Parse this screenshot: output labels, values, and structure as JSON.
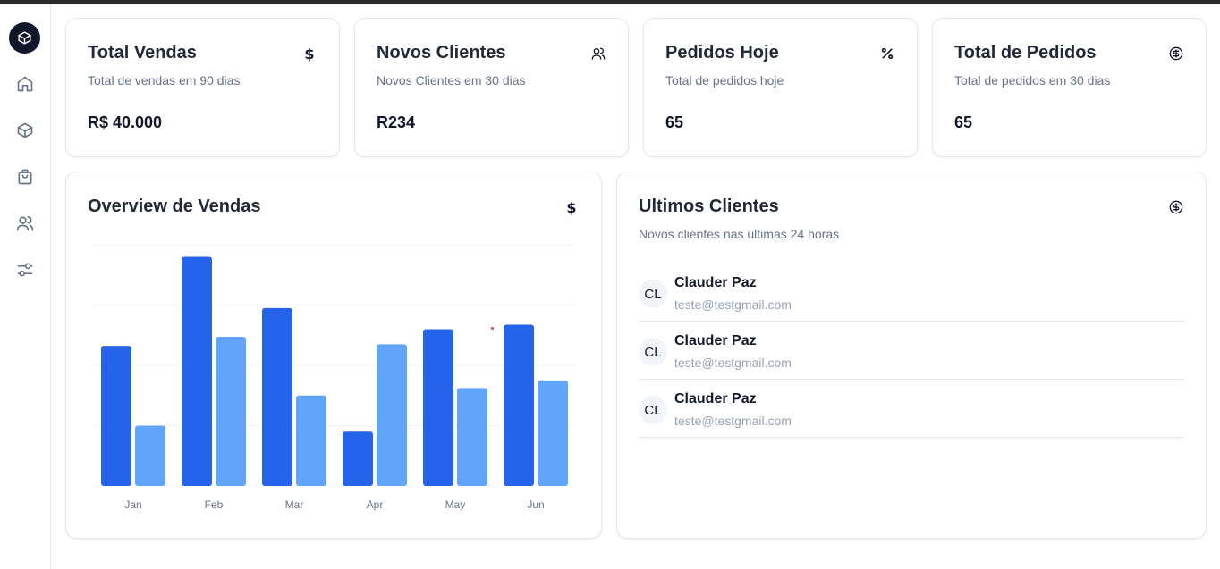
{
  "stats": [
    {
      "title": "Total Vendas",
      "subtitle": "Total de vendas em 90 dias",
      "value": "R$ 40.000",
      "icon": "dollar-icon"
    },
    {
      "title": "Novos Clientes",
      "subtitle": "Novos Clientes em 30 dias",
      "value": "R234",
      "icon": "users-icon"
    },
    {
      "title": "Pedidos Hoje",
      "subtitle": "Total de pedidos hoje",
      "value": "65",
      "icon": "percent-icon"
    },
    {
      "title": "Total de Pedidos",
      "subtitle": "Total de pedidos em 30 dias",
      "value": "65",
      "icon": "circle-dollar-icon"
    }
  ],
  "overview": {
    "title": "Overview de Vendas",
    "icon": "dollar-icon"
  },
  "clients": {
    "title": "Ultimos Clientes",
    "subtitle": "Novos clientes nas ultimas 24 horas",
    "icon": "circle-dollar-icon",
    "items": [
      {
        "initials": "CL",
        "name": "Clauder Paz",
        "email": "teste@testgmail.com"
      },
      {
        "initials": "CL",
        "name": "Clauder Paz",
        "email": "teste@testgmail.com"
      },
      {
        "initials": "CL",
        "name": "Clauder Paz",
        "email": "teste@testgmail.com"
      }
    ]
  },
  "sidebar": {
    "items": [
      "logo-package-icon",
      "home-icon",
      "package-icon",
      "shopping-bag-icon",
      "users-icon",
      "settings-sliders-icon"
    ]
  },
  "colors": {
    "primary": "#2563eb",
    "secondary": "#60a5fa",
    "dark": "#0f172a"
  },
  "chart_data": {
    "type": "bar",
    "categories": [
      "Jan",
      "Feb",
      "Mar",
      "Apr",
      "May",
      "Jun"
    ],
    "series": [
      {
        "values": [
          4650,
          7600,
          5900,
          1800,
          5200,
          5350
        ]
      },
      {
        "values": [
          2000,
          4950,
          3000,
          4700,
          3250,
          3500
        ]
      }
    ],
    "ylim": [
      0,
      8000
    ],
    "grid": true
  }
}
